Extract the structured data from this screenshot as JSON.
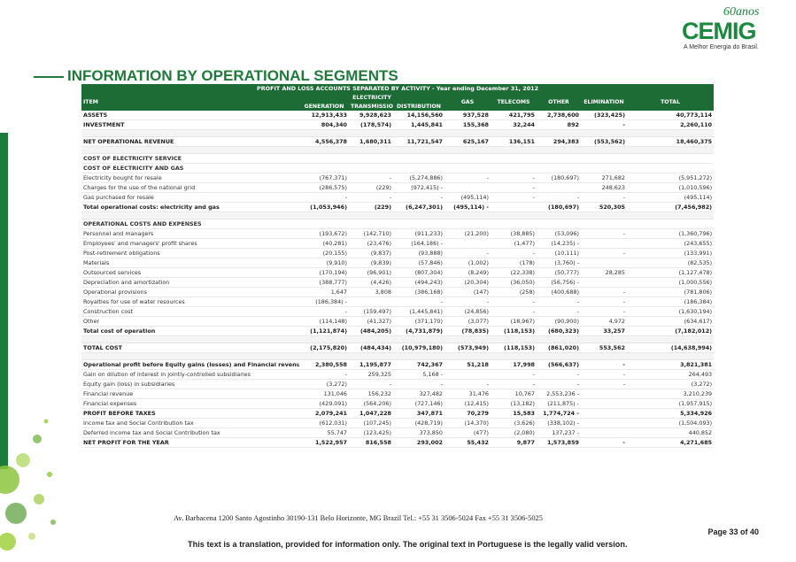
{
  "logo": {
    "anniversary": "60anos",
    "name": "CEMIG",
    "tagline": "A Melhor Energia do Brasil."
  },
  "page_title": "INFORMATION BY OPERATIONAL SEGMENTS",
  "table": {
    "caption": "PROFIT AND LOSS ACCOUNTS SEPARATED BY ACTIVITY - Year ending December 31, 2012",
    "headers": {
      "item": "ITEM",
      "electricity": "ELECTRICITY",
      "generation": "GENERATION",
      "transmission": "TRANSMISSION",
      "distribution": "DISTRIBUTION",
      "gas": "GAS",
      "telecoms": "TELECOMS",
      "other": "OTHER",
      "elimination": "ELIMINATION",
      "total": "TOTAL"
    },
    "rows": [
      {
        "type": "bold",
        "label": "ASSETS",
        "v": [
          "12,913,433",
          "9,928,623",
          "14,156,560",
          "937,528",
          "421,795",
          "2,738,600",
          "(323,425)",
          "40,773,114"
        ]
      },
      {
        "type": "bold",
        "label": "INVESTMENT",
        "v": [
          "804,340",
          "(178,574)",
          "1,445,841",
          "155,368",
          "32,244",
          "892",
          "-",
          "2,260,110"
        ]
      },
      {
        "type": "spacer"
      },
      {
        "type": "bold",
        "label": "NET OPERATIONAL REVENUE",
        "v": [
          "4,556,378",
          "1,680,311",
          "11,721,547",
          "625,167",
          "136,151",
          "294,383",
          "(553,562)",
          "18,460,375"
        ]
      },
      {
        "type": "spacer"
      },
      {
        "type": "sub",
        "label": "COST OF ELECTRICITY SERVICE",
        "v": [
          "",
          "",
          "",
          "",
          "",
          "",
          "",
          ""
        ]
      },
      {
        "type": "sub",
        "label": "COST OF ELECTRICITY AND GAS",
        "v": [
          "",
          "",
          "",
          "",
          "",
          "",
          "",
          ""
        ]
      },
      {
        "type": "normal",
        "label": "Electricity bought for resale",
        "v": [
          "(767,371)",
          "-",
          "(5,274,886)",
          "-",
          "-",
          "(180,697)",
          "271,682",
          "(5,951,272)"
        ]
      },
      {
        "type": "normal",
        "label": "Charges for the use of the national grid",
        "v": [
          "(286,575)",
          "(229)",
          "(972,415) -",
          "",
          "-",
          "",
          "248,623",
          "(1,010,596)"
        ]
      },
      {
        "type": "normal",
        "label": "Gas purchased for resale",
        "v": [
          "-",
          "-",
          "-",
          "(495,114)",
          "-",
          "-",
          "-",
          "(495,114)"
        ]
      },
      {
        "type": "bold total",
        "label": "Total operational costs: electricity and gas",
        "v": [
          "(1,053,946)",
          "(229)",
          "(6,247,301)",
          "(495,114) -",
          "",
          "(180,697)",
          "520,305",
          "(7,456,982)"
        ]
      },
      {
        "type": "spacer"
      },
      {
        "type": "sub",
        "label": "OPERATIONAL COSTS AND EXPENSES",
        "v": [
          "",
          "",
          "",
          "",
          "",
          "",
          "",
          ""
        ]
      },
      {
        "type": "normal",
        "label": "Personnel and managers",
        "v": [
          "(193,672)",
          "(142,710)",
          "(911,233)",
          "(21,200)",
          "(38,885)",
          "(53,096)",
          "-",
          "(1,360,796)"
        ]
      },
      {
        "type": "normal",
        "label": "Employees' and managers' profit shares",
        "v": [
          "(40,281)",
          "(23,476)",
          "(164,186) -",
          "",
          "(1,477)",
          "(14,235) -",
          "",
          "(243,655)"
        ]
      },
      {
        "type": "normal",
        "label": "Post-retirement obligations",
        "v": [
          "(20,155)",
          "(9,837)",
          "(93,888)",
          "-",
          "-",
          "(10,111)",
          "-",
          "(133,991)"
        ]
      },
      {
        "type": "normal",
        "label": "Materials",
        "v": [
          "(9,910)",
          "(9,839)",
          "(57,846)",
          "(1,002)",
          "(178)",
          "(3,760) -",
          "",
          "(82,535)"
        ]
      },
      {
        "type": "normal",
        "label": "Outsourced services",
        "v": [
          "(170,194)",
          "(96,901)",
          "(807,304)",
          "(8,249)",
          "(22,338)",
          "(50,777)",
          "28,285",
          "(1,127,478)"
        ]
      },
      {
        "type": "normal",
        "label": "Depreciation and amortization",
        "v": [
          "(388,777)",
          "(4,426)",
          "(494,243)",
          "(20,304)",
          "(36,050)",
          "(56,756) -",
          "",
          "(1,000,556)"
        ]
      },
      {
        "type": "normal",
        "label": "Operational provisions",
        "v": [
          "1,647",
          "3,808",
          "(386,168)",
          "(147)",
          "(258)",
          "(400,688)",
          "-",
          "(781,806)"
        ]
      },
      {
        "type": "normal",
        "label": "Royalties for use of water resources",
        "v": [
          "(186,384) -",
          "",
          "-",
          "-",
          "-",
          "-",
          "-",
          "(186,384)"
        ]
      },
      {
        "type": "normal",
        "label": "Construction cost",
        "v": [
          "-",
          "(159,497)",
          "(1,445,841)",
          "(24,856)",
          "-",
          "-",
          "-",
          "(1,630,194)"
        ]
      },
      {
        "type": "normal",
        "label": "Other",
        "v": [
          "(114,148)",
          "(41,327)",
          "(371,170)",
          "(3,077)",
          "(18,967)",
          "(90,900)",
          "4,972",
          "(634,617)"
        ]
      },
      {
        "type": "bold total",
        "label": "Total cost of operation",
        "v": [
          "(1,121,874)",
          "(484,205)",
          "(4,731,879)",
          "(78,835)",
          "(118,153)",
          "(680,323)",
          "33,257",
          "(7,182,012)"
        ]
      },
      {
        "type": "spacer"
      },
      {
        "type": "bold",
        "label": "TOTAL COST",
        "v": [
          "(2,175,820)",
          "(484,434)",
          "(10,979,180)",
          "(573,949)",
          "(118,153)",
          "(861,020)",
          "553,562",
          "(14,638,994)"
        ]
      },
      {
        "type": "spacer"
      },
      {
        "type": "bold",
        "label": "Operational profit before Equity gains (losses) and Financial revenue",
        "v": [
          "2,380,558",
          "1,195,877",
          "742,367",
          "51,218",
          "17,998",
          "(566,637)",
          "-",
          "3,821,381"
        ]
      },
      {
        "type": "normal",
        "label": "Gain on dilution of interest in jointly-controlled subsidiaries",
        "v": [
          "-",
          "259,325",
          "5,168 -",
          "",
          "-",
          "-",
          "-",
          "264,493"
        ]
      },
      {
        "type": "normal",
        "label": "Equity gain (loss) in subsidiaries",
        "v": [
          "(3,272)",
          "-",
          "-",
          "-",
          "-",
          "-",
          "-",
          "(3,272)"
        ]
      },
      {
        "type": "normal",
        "label": "Financial revenue",
        "v": [
          "131,046",
          "156,232",
          "327,482",
          "31,476",
          "10,767",
          "2,553,236 -",
          "",
          "3,210,239"
        ]
      },
      {
        "type": "normal",
        "label": "Financial expenses",
        "v": [
          "(429,091)",
          "(564,206)",
          "(727,146)",
          "(12,415)",
          "(13,182)",
          "(211,875) -",
          "",
          "(1,957,915)"
        ]
      },
      {
        "type": "bold total",
        "label": "PROFIT BEFORE TAXES",
        "v": [
          "2,079,241",
          "1,047,228",
          "347,871",
          "70,279",
          "15,583",
          "1,774,724 -",
          "",
          "5,334,926"
        ]
      },
      {
        "type": "normal",
        "label": "Income tax and Social Contribution tax",
        "v": [
          "(612,031)",
          "(107,245)",
          "(428,719)",
          "(14,370)",
          "(3,626)",
          "(338,102) -",
          "",
          "(1,504,093)"
        ]
      },
      {
        "type": "normal",
        "label": "Deferred income tax and Social Contribution tax",
        "v": [
          "55,747",
          "(123,425)",
          "373,850",
          "(477)",
          "(2,080)",
          "137,237 -",
          "",
          "440,852"
        ]
      },
      {
        "type": "bold total",
        "label": "NET PROFIT FOR THE YEAR",
        "v": [
          "1,522,957",
          "816,558",
          "293,002",
          "55,432",
          "9,877",
          "1,573,859",
          "-",
          "4,271,685"
        ]
      }
    ]
  },
  "footer": {
    "address": "Av. Barbacena 1200     Santo Agostinho     30190-131 Belo Horizonte, MG     Brazil     Tel.: +55 31 3506-5024     Fax +55 31 3506-5025",
    "page": "Page 33 of 40",
    "note": "This text is a translation, provided for information only. The original text in Portuguese is the legally valid version."
  },
  "colors": {
    "brand_green": "#1b8a3f",
    "header_green": "#1d6b35",
    "lime": "#9acd32"
  }
}
